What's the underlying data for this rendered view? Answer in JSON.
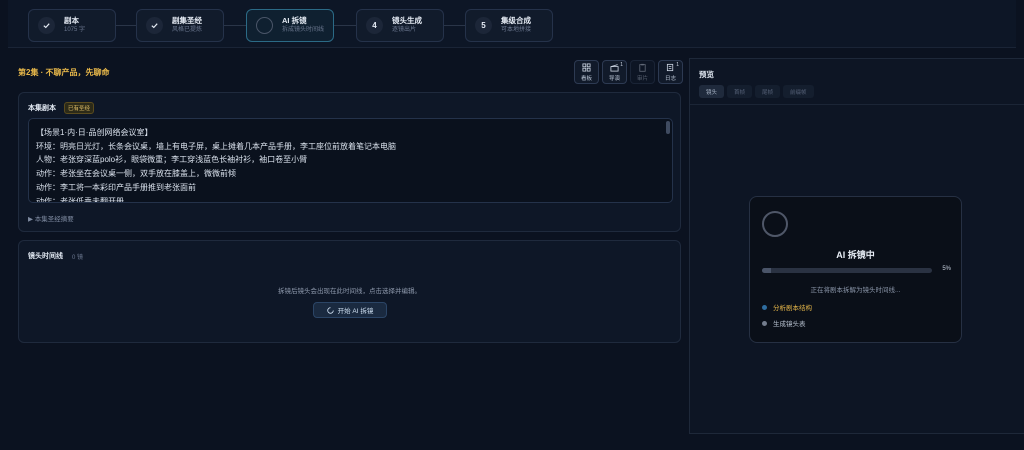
{
  "stepper": {
    "steps": [
      {
        "title": "剧本",
        "subtitle": "1075 字",
        "state": "done"
      },
      {
        "title": "剧集圣经",
        "subtitle": "风格已提炼",
        "state": "done"
      },
      {
        "title": "AI 拆镜",
        "subtitle": "拆成镜头时间线",
        "state": "active"
      },
      {
        "title": "镜头生成",
        "subtitle": "逐镜出片",
        "number": "4",
        "state": "pending"
      },
      {
        "title": "集级合成",
        "subtitle": "可本地拼接",
        "number": "5",
        "state": "pending"
      }
    ]
  },
  "episode": {
    "title": "第2集 · 不聊产品，先聊命"
  },
  "toolbar": [
    {
      "label": "看板",
      "icon": "grid-icon",
      "badge": ""
    },
    {
      "label": "导演",
      "icon": "clapper-icon",
      "badge": "1"
    },
    {
      "label": "审片",
      "icon": "clipboard-icon",
      "badge": ""
    },
    {
      "label": "日志",
      "icon": "log-icon",
      "badge": "1"
    }
  ],
  "script_panel": {
    "title": "本集剧本",
    "tag": "已有圣经",
    "lines": [
      "【场景1·内·日·品创网络会议室】",
      "环境：明亮日光灯，长条会议桌，墙上有电子屏，桌上摊着几本产品手册，李工座位前放着笔记本电脑",
      "人物：老张穿深蓝polo衫，眼袋微重；李工穿浅蓝色长袖衬衫，袖口卷至小臂",
      "动作：老张坐在会议桌一侧，双手放在膝盖上，微微前倾",
      "动作：李工将一本彩印产品手册推到老张面前",
      "动作：老张低垂未翻开册"
    ],
    "summary": "▶ 本集圣经摘要"
  },
  "timeline_panel": {
    "title": "镜头时间线",
    "count": "0 镜",
    "empty_hint": "拆镜后镜头会出现在此时间线，点击选择并编辑。",
    "start_button": "开始 AI 拆镜"
  },
  "preview": {
    "title": "预览",
    "tabs": [
      "镜头",
      "首帧",
      "尾帧",
      "前缀帧"
    ],
    "card": {
      "title": "AI 拆镜中",
      "progress_percent": 5,
      "progress_label": "5%",
      "status": "正在将剧本拆解为镜头时间线...",
      "steps": [
        {
          "label": "分析剧本结构",
          "state": "active"
        },
        {
          "label": "生成镜头表",
          "state": "pending"
        }
      ]
    }
  },
  "colors": {
    "accent_gold": "#e8b84a",
    "background": "#0b1220",
    "active_step_border": "#2b6a86"
  }
}
